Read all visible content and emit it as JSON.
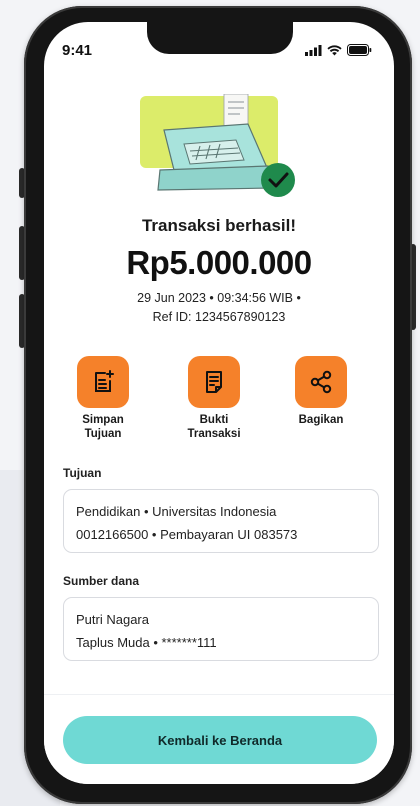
{
  "status_bar": {
    "time": "9:41"
  },
  "result": {
    "title": "Transaksi berhasil!",
    "amount": "Rp5.000.000",
    "meta_line1": "29 Jun 2023 • 09:34:56 WIB •",
    "meta_line2": "Ref ID: 1234567890123"
  },
  "actions": [
    {
      "label_line1": "Simpan",
      "label_line2": "Tujuan",
      "icon": "save-list-icon"
    },
    {
      "label_line1": "Bukti",
      "label_line2": "Transaksi",
      "icon": "receipt-icon"
    },
    {
      "label_line1": "Bagikan",
      "label_line2": "",
      "icon": "share-icon"
    }
  ],
  "tujuan": {
    "label": "Tujuan",
    "line1": "Pendidikan • Universitas Indonesia",
    "line2": "0012166500 • Pembayaran UI 083573"
  },
  "sumber_dana": {
    "label": "Sumber dana",
    "line1": "Putri Nagara",
    "line2": "Taplus Muda • *******111"
  },
  "footer": {
    "home_button": "Kembali ke Beranda"
  },
  "colors": {
    "accent_orange": "#f5812a",
    "accent_teal": "#6fd9d4",
    "hero_lime": "#dcec6a",
    "success_green": "#1f8a4c"
  }
}
